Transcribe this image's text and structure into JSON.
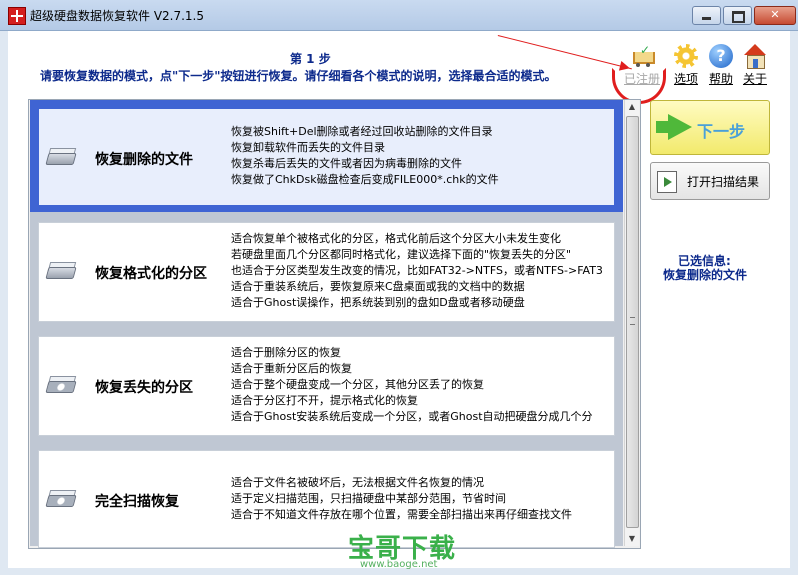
{
  "window": {
    "title": "超级硬盘数据恢复软件 V2.7.1.5",
    "min_glyph": "",
    "max_glyph": "",
    "close_glyph": "✕"
  },
  "header": {
    "step": "第 1 步",
    "instruction": "请要恢复数据的模式，点\"下一步\"按钮进行恢复。请仔细看各个模式的说明，选择最合适的模式。"
  },
  "toolbar": {
    "registered": {
      "label": "已注册",
      "icon": "cart-check-icon"
    },
    "options": {
      "label": "选项",
      "icon": "gear-icon"
    },
    "help": {
      "label": "帮助",
      "icon": "help-icon",
      "glyph": "?"
    },
    "about": {
      "label": "关于",
      "icon": "house-icon"
    }
  },
  "modes": [
    {
      "name": "恢复删除的文件",
      "selected": true,
      "icon": "hard-disk-icon",
      "desc": [
        "恢复被Shift+Del删除或者经过回收站删除的文件目录",
        "恢复卸载软件而丢失的文件目录",
        "恢复杀毒后丢失的文件或者因为病毒删除的文件",
        "恢复做了ChkDsk磁盘检查后变成FILE000*.chk的文件"
      ]
    },
    {
      "name": "恢复格式化的分区",
      "selected": false,
      "icon": "hard-disk-icon",
      "desc": [
        "适合恢复单个被格式化的分区，格式化前后这个分区大小未发生变化",
        "若硬盘里面几个分区都同时格式化，建议选择下面的\"恢复丢失的分区\"",
        "也适合于分区类型发生改变的情况，比如FAT32->NTFS，或者NTFS->FAT3",
        "适合于重装系统后，要恢复原来C盘桌面或我的文档中的数据",
        "适合于Ghost误操作，把系统装到别的盘如D盘或者移动硬盘"
      ]
    },
    {
      "name": "恢复丢失的分区",
      "selected": false,
      "icon": "hard-disk-platter-icon",
      "desc": [
        "适合于删除分区的恢复",
        "适合于重新分区后的恢复",
        "适合于整个硬盘变成一个分区，其他分区丢了的恢复",
        "适合于分区打不开，提示格式化的恢复",
        "适合于Ghost安装系统后变成一个分区，或者Ghost自动把硬盘分成几个分"
      ]
    },
    {
      "name": "完全扫描恢复",
      "selected": false,
      "icon": "hard-disk-platter-icon",
      "desc": [
        "适合于文件名被破坏后，无法根据文件名恢复的情况",
        "适于定义扫描范围，只扫描硬盘中某部分范围，节省时间",
        "适合于不知道文件存放在哪个位置，需要全部扫描出来再仔细查找文件"
      ]
    }
  ],
  "scrollbar": {
    "up": "▲",
    "down": "▼"
  },
  "actions": {
    "next": "下一步",
    "open_scan": "打开扫描结果"
  },
  "selection": {
    "title": "已选信息:",
    "value": "恢复删除的文件"
  },
  "watermark": {
    "text": "宝哥下载",
    "url": "www.baoge.net"
  },
  "colors": {
    "selected_band": "#3f64d3",
    "heading": "#0d2a8c",
    "annotation": "#e01e1e",
    "next_button": "#f2ea6c"
  }
}
